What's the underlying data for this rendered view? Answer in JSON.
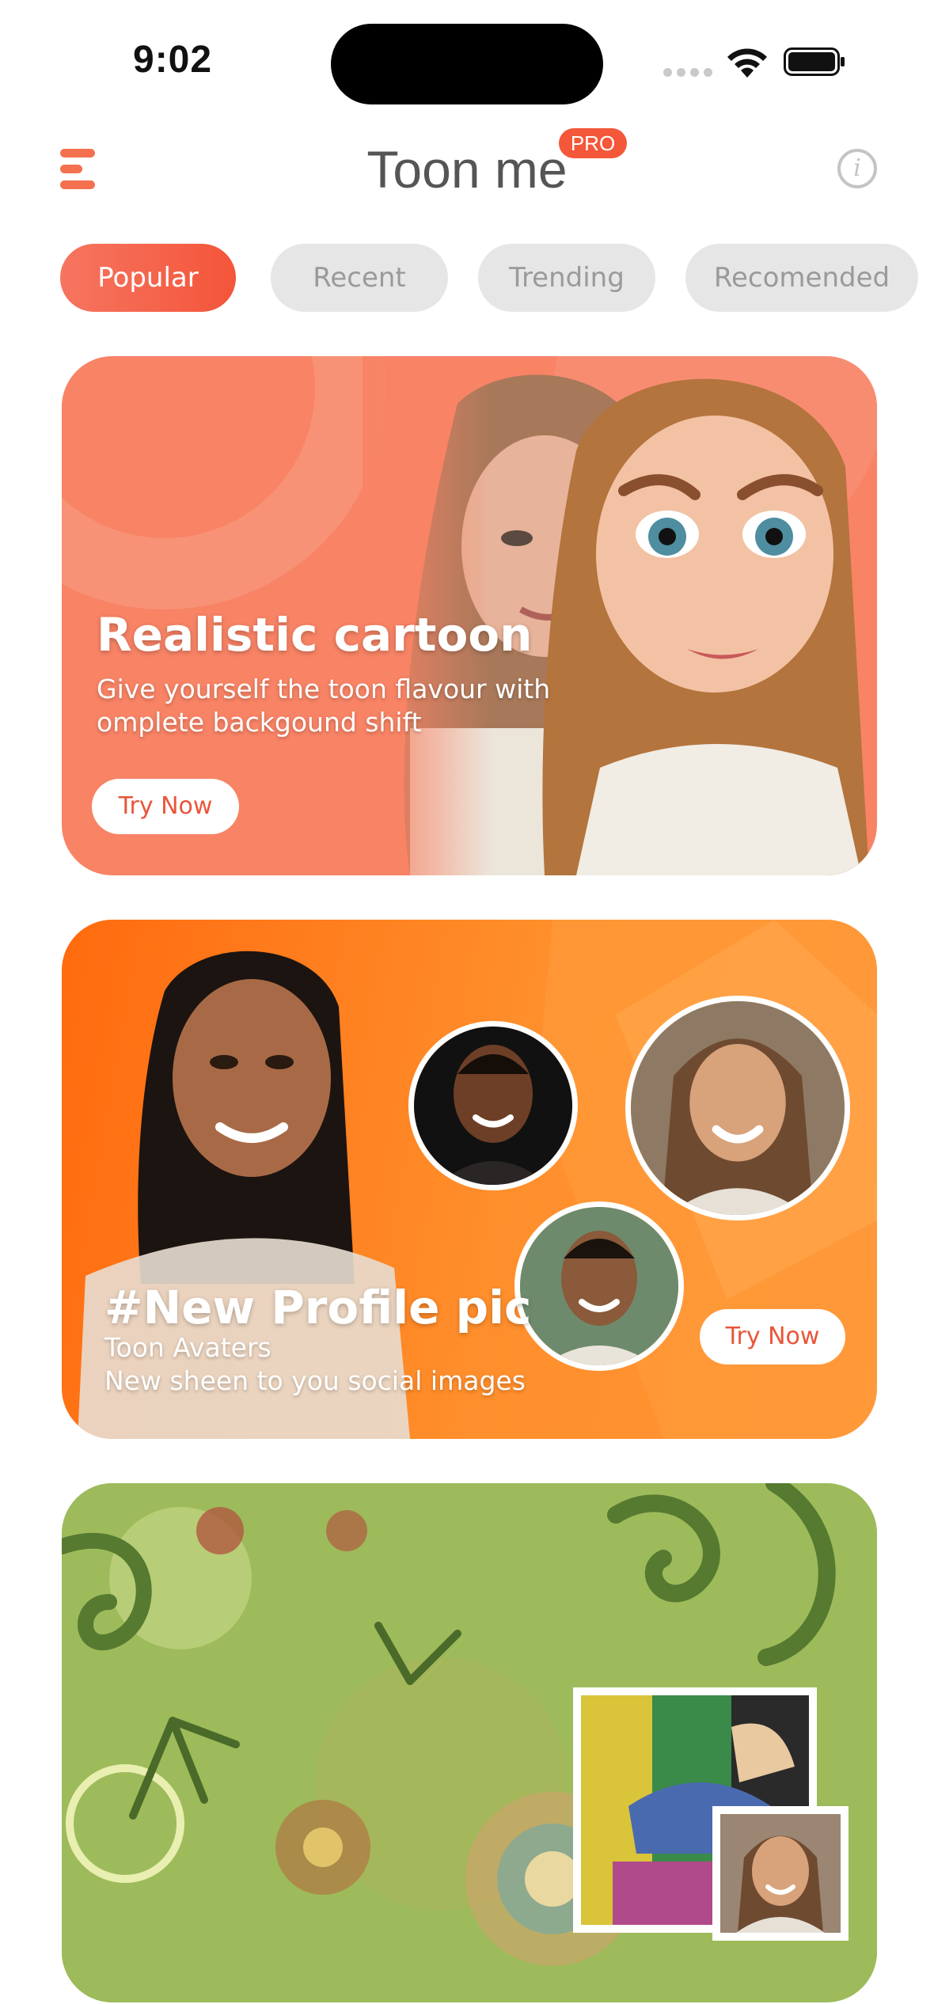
{
  "status_bar": {
    "time": "9:02"
  },
  "header": {
    "title": "Toon me",
    "pro_badge": "PRO"
  },
  "tabs": [
    {
      "label": "Popular",
      "active": true
    },
    {
      "label": "Recent",
      "active": false
    },
    {
      "label": "Trending",
      "active": false
    },
    {
      "label": "Recomended",
      "active": false
    }
  ],
  "cards": [
    {
      "title": "Realistic cartoon",
      "desc_line1": "Give yourself the toon flavour with",
      "desc_line2": "omplete backgound shift",
      "button": "Try Now"
    },
    {
      "title": "#New Profile pic",
      "desc_line1": "Toon Avaters",
      "desc_line2": "New sheen to you social images",
      "button": "Try Now"
    }
  ],
  "colors": {
    "accent": "#f4573a",
    "card1_bg": "#f88365",
    "card2_bg": "#ff8a25",
    "card3_bg": "#94b455"
  },
  "icons": {
    "menu": "menu-icon",
    "info": "info-icon"
  }
}
